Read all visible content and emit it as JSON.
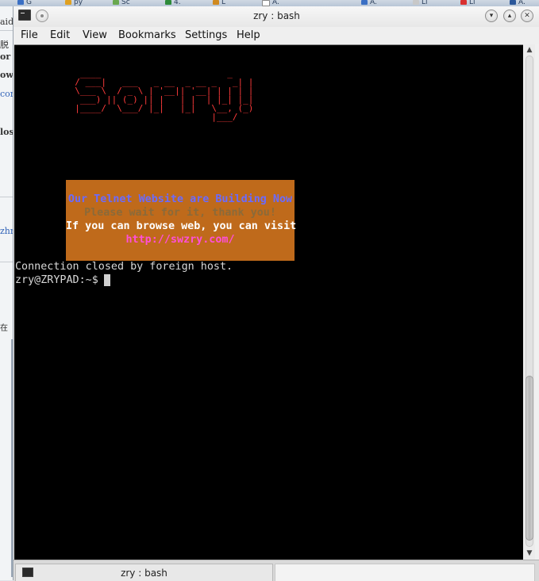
{
  "window": {
    "title": "zry : bash"
  },
  "menubar": {
    "items": [
      "File",
      "Edit",
      "View",
      "Bookmarks",
      "Settings",
      "Help"
    ]
  },
  "terminal": {
    "ascii_art": "   ____                        _ \n  / ___|   ___   _ __  _ __ _   _| |\n  \\___ \\  / _ \\ | '__|| '__| | | | |\n   ___) || (_) || |   | |  | |_| |_|\n  |____/  \\___/ |_|   |_|   \\__, (_)\n                            |___/   ",
    "banner": {
      "line1": "Our Telnet Website are Building Now",
      "line2": "Please wait for it, thank you!",
      "line3": "If you can browse web, you can visit",
      "line4": "http://swzry.com/"
    },
    "banner_colors": {
      "background": "#bf6a1b",
      "line1": "#6a6aff",
      "line2": "#8a6a3a",
      "line3": "#ffffff",
      "line4": "#ff4fd8"
    },
    "ascii_color": "#ff3b3b",
    "closed_message": "Connection closed by foreign host.",
    "prompt": "zry@ZRYPAD:~$ "
  },
  "tabbar": {
    "tab_label": "zry : bash"
  },
  "background": {
    "taskbar_tabs": [
      "G",
      "py",
      "Sc",
      "4.",
      "L",
      "A.",
      "A.",
      "Li",
      "Li",
      "A."
    ],
    "left_fragments": [
      "aid",
      "脱",
      "or",
      "ow",
      "con",
      "los",
      "zhr",
      "在"
    ]
  },
  "icons": {
    "app": "terminal-icon",
    "sticky": "pin-icon",
    "minimize": "chevron-down-icon",
    "maximize": "chevron-up-icon",
    "close": "close-icon",
    "scroll_up": "arrow-up-icon",
    "scroll_down": "arrow-down-icon"
  }
}
